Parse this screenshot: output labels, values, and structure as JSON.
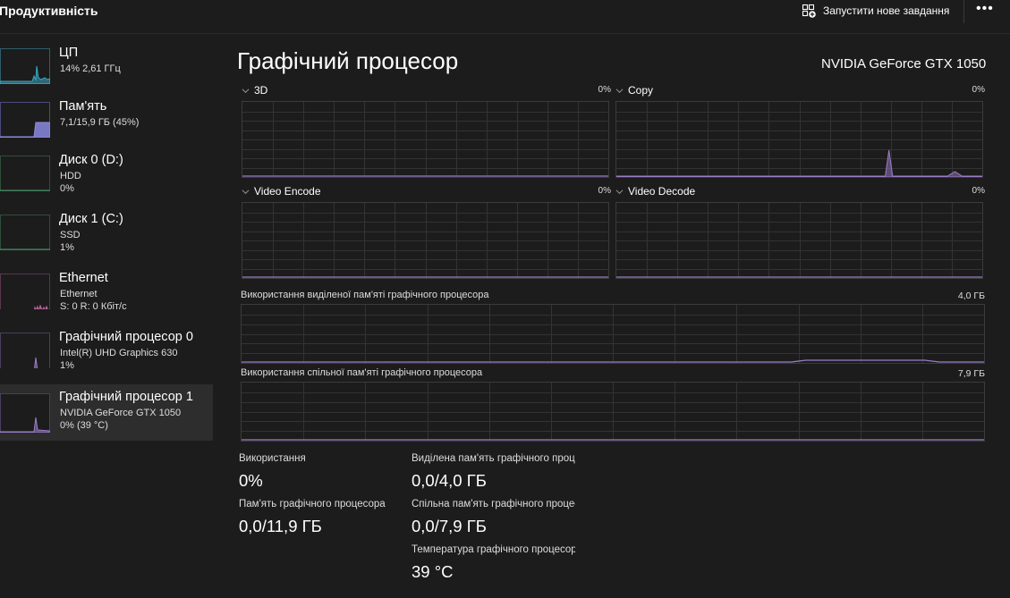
{
  "header": {
    "title": "Продуктивність",
    "new_task_label": "Запустити нове завдання",
    "new_task_icon": "new-task-icon",
    "more_icon": "more-options-icon"
  },
  "sidebar": {
    "items": [
      {
        "name": "ЦП",
        "line2": "14% 2,61 ГГц",
        "line3": "",
        "color": "#3aa8c1",
        "selected": false
      },
      {
        "name": "Пам'ять",
        "line2": "7,1/15,9 ГБ (45%)",
        "line3": "",
        "color": "#8a8ae0",
        "selected": false
      },
      {
        "name": "Диск 0 (D:)",
        "line2": "HDD",
        "line3": "0%",
        "color": "#4e9e6e",
        "selected": false
      },
      {
        "name": "Диск 1 (C:)",
        "line2": "SSD",
        "line3": "1%",
        "color": "#4e9e6e",
        "selected": false
      },
      {
        "name": "Ethernet",
        "line2": "Ethernet",
        "line3": "S: 0 R: 0 Кбіт/с",
        "color": "#c46aa6",
        "selected": false
      },
      {
        "name": "Графічний процесор 0",
        "line2": "Intel(R) UHD Graphics 630",
        "line3": "1%",
        "color": "#9a7cc8",
        "selected": false
      },
      {
        "name": "Графічний процесор 1",
        "line2": "NVIDIA GeForce GTX 1050",
        "line3": "0% (39 °C)",
        "color": "#9a7cc8",
        "selected": true
      }
    ]
  },
  "main": {
    "title": "Графічний процесор",
    "model": "NVIDIA GeForce GTX 1050",
    "engines": [
      {
        "name": "3D",
        "percent": "0%"
      },
      {
        "name": "Copy",
        "percent": "0%"
      },
      {
        "name": "Video Encode",
        "percent": "0%"
      },
      {
        "name": "Video Decode",
        "percent": "0%"
      }
    ],
    "dedicated_memory": {
      "label": "Використання виділеної пам'яті графічного процесора",
      "max": "4,0 ГБ"
    },
    "shared_memory": {
      "label": "Використання спільної пам'яті графічного процесора",
      "max": "7,9 ГБ"
    },
    "stats": {
      "utilization_label": "Використання",
      "utilization_value": "0%",
      "gpu_memory_label": "Пам'ять графічного процесора",
      "gpu_memory_value": "0,0/11,9 ГБ",
      "dedicated_label": "Виділена пам'ять графічного процесора",
      "dedicated_value": "0,0/4,0 ГБ",
      "shared_label": "Спільна пам'ять графічного процесора",
      "shared_value": "0,0/7,9 ГБ",
      "temperature_label": "Температура графічного процесора",
      "temperature_value": "39 °C"
    }
  },
  "colors": {
    "background": "#1c1c1c",
    "graph_line": "#9a7cc8",
    "grid": "#333333"
  }
}
